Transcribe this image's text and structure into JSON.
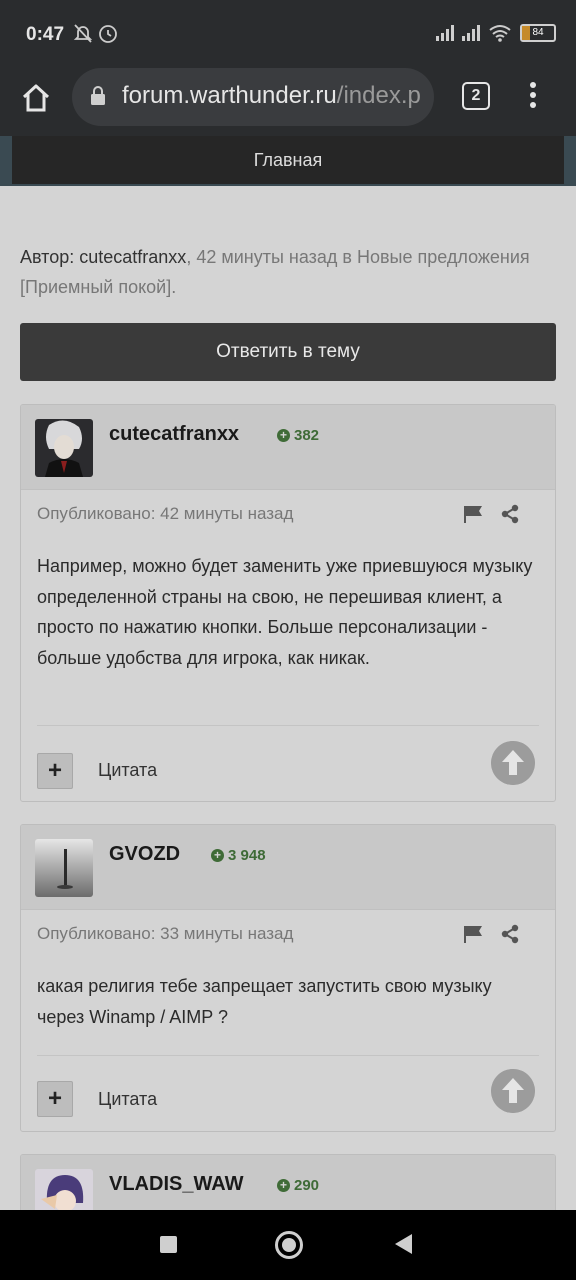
{
  "status_bar": {
    "time": "0:47",
    "battery": "84"
  },
  "browser": {
    "url_host": "forum.warthunder.ru",
    "url_path": "/index.p",
    "tab_count": "2"
  },
  "page": {
    "nav_label": "Главная",
    "author_prefix": "Автор: ",
    "author_name": "cutecatfranxx",
    "author_suffix": ", 42 минуты назад в Новые предложения [Приемный покой].",
    "reply_button": "Ответить в тему"
  },
  "posts": [
    {
      "author": "cutecatfranxx",
      "reputation": "382",
      "published": "Опубликовано: 42 минуты назад",
      "body": "Например, можно будет заменить уже приевшуюся музыку определенной страны на свою, не перешивая клиент, а просто по нажатию кнопки. Больше персонализации - больше удобства для игрока, как никак.",
      "plus": "+",
      "quote": "Цитата"
    },
    {
      "author": "GVOZD",
      "reputation": "3 948",
      "published": "Опубликовано: 33 минуты назад",
      "body": "какая религия тебе запрещает запустить свою музыку через Winamp / AIMP ?",
      "plus": "+",
      "quote": "Цитата"
    },
    {
      "author": "VLADIS_WAW",
      "reputation": "290"
    }
  ],
  "icons": {
    "status": [
      "mute-bell-icon",
      "alarm-icon",
      "signal-icon",
      "wifi-icon",
      "battery-icon"
    ],
    "browser": [
      "home-icon",
      "lock-icon",
      "tabs-icon",
      "more-menu-icon"
    ],
    "post": [
      "reputation-plus-icon",
      "report-flag-icon",
      "share-icon",
      "upvote-icon"
    ],
    "system_nav": [
      "recent-apps-icon",
      "home-circle-icon",
      "back-icon"
    ]
  },
  "colors": {
    "reputation": "#3f6b37",
    "header": "#262626",
    "reply_button": "#3a3a3a"
  }
}
